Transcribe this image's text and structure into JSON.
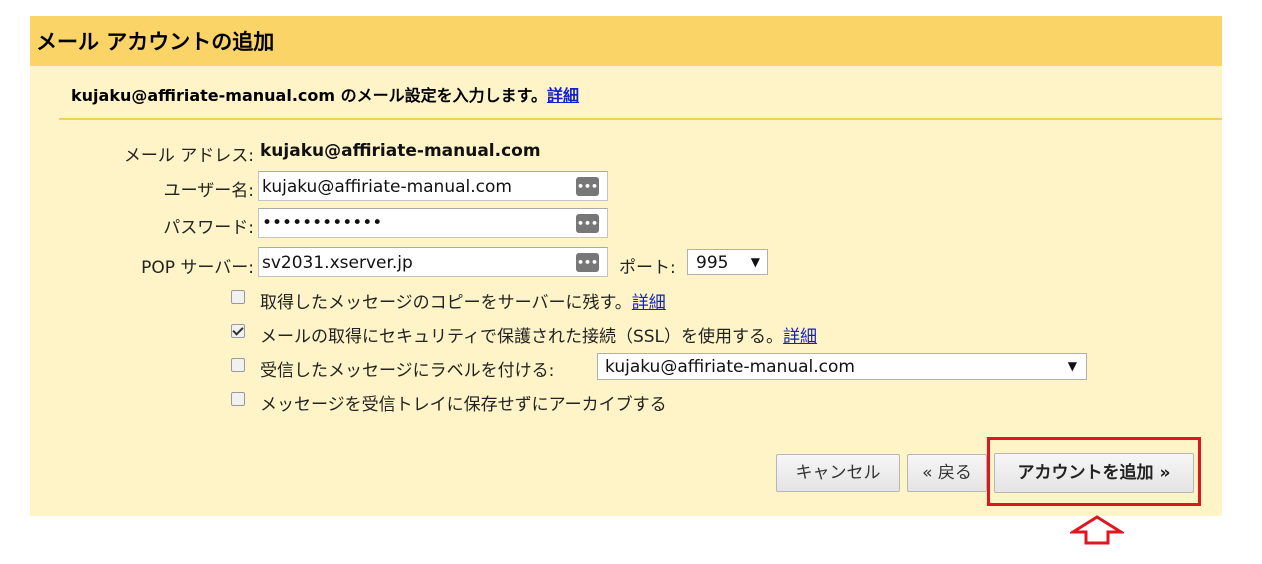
{
  "dialog": {
    "title": "メール アカウントの追加",
    "subtitle_prefix": "kujaku@affiriate-manual.com のメール設定を入力します。",
    "subtitle_link": "詳細"
  },
  "form": {
    "email_label": "メール アドレス:",
    "email_value": "kujaku@affiriate-manual.com",
    "username_label": "ユーザー名:",
    "username_value": "kujaku@affiriate-manual.com",
    "password_label": "パスワード:",
    "password_value": "••••••••••••",
    "pop_label": "POP サーバー:",
    "pop_value": "sv2031.xserver.jp",
    "port_label": "ポート:",
    "port_value": "995",
    "dots_glyph": "•••"
  },
  "options": {
    "leave_copy": {
      "label": "取得したメッセージのコピーをサーバーに残す。",
      "link": "詳細",
      "checked": false
    },
    "ssl": {
      "label": "メールの取得にセキュリティで保護された接続（SSL）を使用する。",
      "link": "詳細",
      "checked": true
    },
    "label_messages": {
      "label": "受信したメッセージにラベルを付ける:",
      "select_value": "kujaku@affiriate-manual.com",
      "checked": false
    },
    "archive": {
      "label": "メッセージを受信トレイに保存せずにアーカイブする",
      "checked": false
    }
  },
  "buttons": {
    "cancel": "キャンセル",
    "back": "« 戻る",
    "add_account": "アカウントを追加 »"
  },
  "colors": {
    "header_bg": "#fbd468",
    "dialog_bg": "#fff4c8",
    "highlight": "#e0161e",
    "link": "#1122cc"
  },
  "icons": {
    "dropdown_arrow": "▼",
    "annotation_arrow": "up-arrow-outline"
  }
}
